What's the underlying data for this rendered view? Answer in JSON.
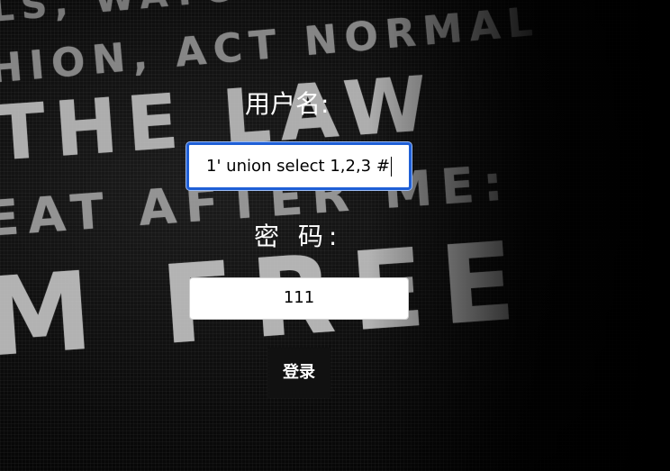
{
  "background": {
    "lines": [
      "LS, WATCH YOUR TV",
      "HION, ACT NORMAL",
      "THE LAW",
      "EAT AFTER ME:",
      "M FREE"
    ]
  },
  "login_form": {
    "username_label": "用户名:",
    "username_value": "1' union select 1,2,3 #",
    "password_label": "密 码:",
    "password_value": "111",
    "submit_label": "登录"
  },
  "colors": {
    "background": "#000000",
    "focus_border": "#1f5fd6",
    "button": "#111111"
  }
}
